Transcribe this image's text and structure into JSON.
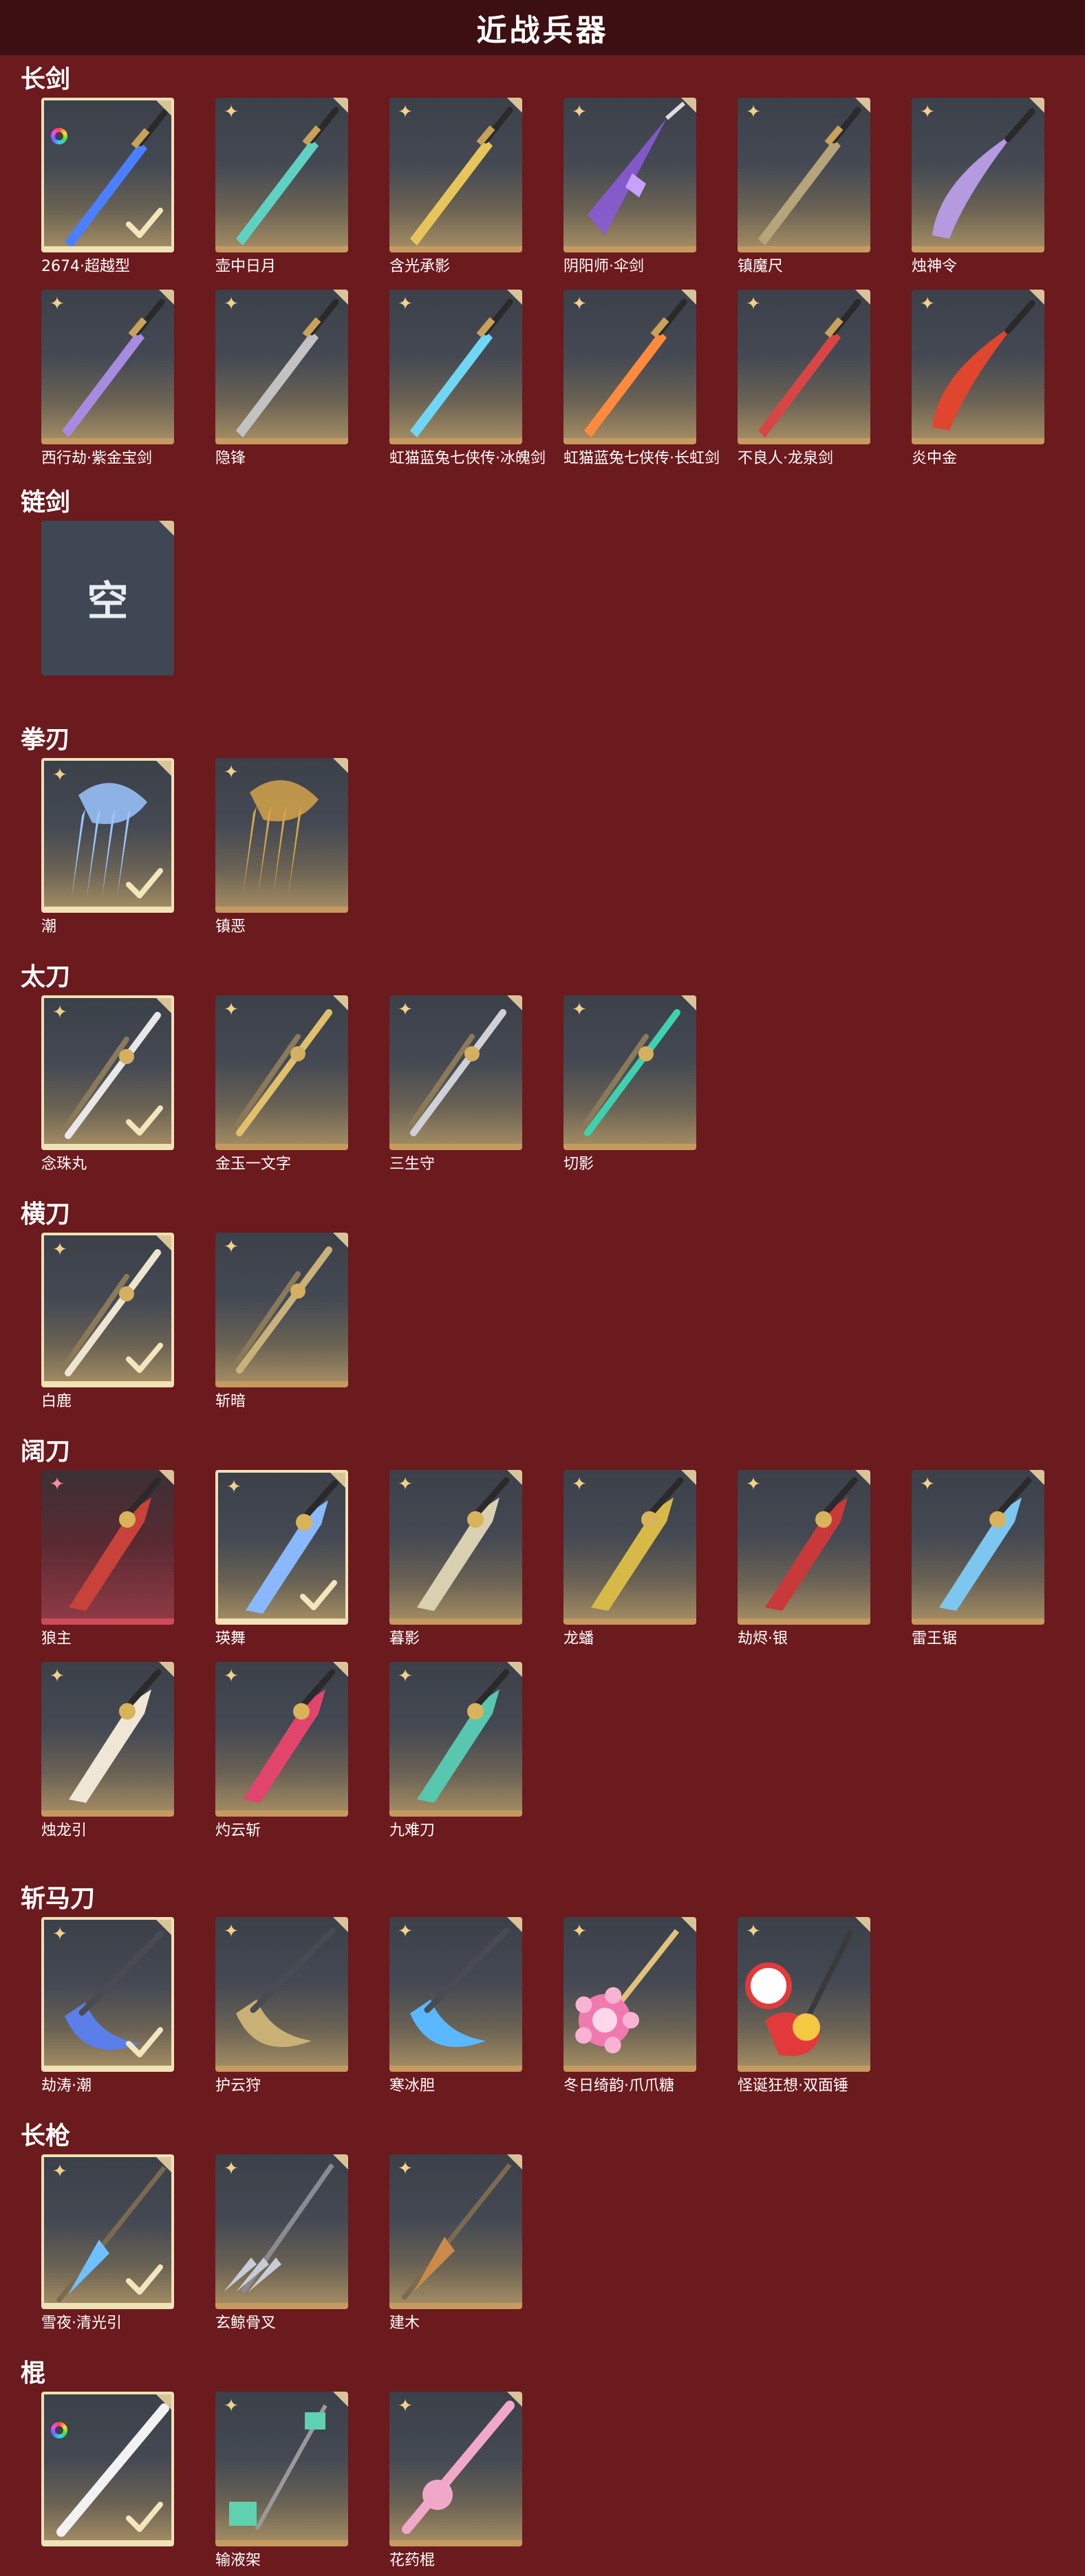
{
  "header": {
    "title": "近战兵器"
  },
  "sections": [
    {
      "title": "长剑",
      "items": [
        {
          "name": "2674·超越型",
          "badge": "rainbow",
          "selected": true,
          "color": "#4a7fff",
          "style": "sword"
        },
        {
          "name": "壶中日月",
          "badge": "star",
          "selected": false,
          "color": "#5fd1c2",
          "style": "sword"
        },
        {
          "name": "含光承影",
          "badge": "star",
          "selected": false,
          "color": "#e7c55a",
          "style": "sword"
        },
        {
          "name": "阴阳师·伞剑",
          "badge": "star",
          "selected": false,
          "color": "#8a5ad6",
          "style": "umbrella"
        },
        {
          "name": "镇魔尺",
          "badge": "star",
          "selected": false,
          "color": "#b6a47b",
          "style": "sword"
        },
        {
          "name": "烛神令",
          "badge": "star",
          "selected": false,
          "color": "#b59ae0",
          "style": "curved"
        },
        {
          "name": "西行劫·紫金宝剑",
          "badge": "star",
          "selected": false,
          "color": "#a78be0",
          "style": "sword"
        },
        {
          "name": "隐锋",
          "badge": "star",
          "selected": false,
          "color": "#c2c2c2",
          "style": "sword"
        },
        {
          "name": "虹猫蓝兔七侠传·冰魄剑",
          "badge": "star",
          "selected": false,
          "color": "#6fd6f3",
          "style": "sword"
        },
        {
          "name": "虹猫蓝兔七侠传·长虹剑",
          "badge": "star",
          "selected": false,
          "color": "#ff8a3d",
          "style": "sword"
        },
        {
          "name": "不良人·龙泉剑",
          "badge": "star",
          "selected": false,
          "color": "#d94545",
          "style": "sword"
        },
        {
          "name": "炎中金",
          "badge": "star",
          "selected": false,
          "color": "#e0452e",
          "style": "curved"
        }
      ]
    },
    {
      "title": "链剑",
      "items": [
        {
          "name": "",
          "badge": "none",
          "selected": false,
          "empty": true,
          "empty_text": "空"
        }
      ]
    },
    {
      "title": "拳刃",
      "items": [
        {
          "name": "潮",
          "badge": "star",
          "selected": true,
          "color": "#9cc6ff",
          "style": "claw"
        },
        {
          "name": "镇恶",
          "badge": "star",
          "selected": false,
          "color": "#d4a34a",
          "style": "claw"
        }
      ]
    },
    {
      "title": "太刀",
      "items": [
        {
          "name": "念珠丸",
          "badge": "star",
          "selected": true,
          "color": "#e8e8e8",
          "style": "katana"
        },
        {
          "name": "金玉一文字",
          "badge": "star",
          "selected": false,
          "color": "#e0c06a",
          "style": "katana"
        },
        {
          "name": "三生守",
          "badge": "star",
          "selected": false,
          "color": "#d0d0d8",
          "style": "katana"
        },
        {
          "name": "切影",
          "badge": "star",
          "selected": false,
          "color": "#3ed1b0",
          "style": "katana"
        }
      ]
    },
    {
      "title": "横刀",
      "items": [
        {
          "name": "白鹿",
          "badge": "star",
          "selected": true,
          "color": "#ece5cf",
          "style": "katana"
        },
        {
          "name": "斩暗",
          "badge": "star",
          "selected": false,
          "color": "#c8b27a",
          "style": "katana"
        }
      ]
    },
    {
      "title": "阔刀",
      "items": [
        {
          "name": "狼主",
          "badge": "pinkstar",
          "selected": false,
          "red": true,
          "color": "#c8423a",
          "style": "broad"
        },
        {
          "name": "瑛舞",
          "badge": "star",
          "selected": true,
          "color": "#8ab8ff",
          "style": "broad"
        },
        {
          "name": "暮影",
          "badge": "star",
          "selected": false,
          "color": "#d8d0b0",
          "style": "broad"
        },
        {
          "name": "龙蟠",
          "badge": "star",
          "selected": false,
          "color": "#d7b948",
          "style": "broad"
        },
        {
          "name": "劫烬·银",
          "badge": "star",
          "selected": false,
          "color": "#c9393a",
          "style": "broad"
        },
        {
          "name": "雷王锯",
          "badge": "star",
          "selected": false,
          "color": "#7cc6ef",
          "style": "broad"
        },
        {
          "name": "烛龙引",
          "badge": "star",
          "selected": false,
          "color": "#efe6d6",
          "style": "broad"
        },
        {
          "name": "灼云斩",
          "badge": "star",
          "selected": false,
          "color": "#e2456b",
          "style": "broad"
        },
        {
          "name": "九难刀",
          "badge": "star",
          "selected": false,
          "color": "#58c7b0",
          "style": "broad"
        }
      ]
    },
    {
      "title": "斩马刀",
      "items": [
        {
          "name": "劫涛·潮",
          "badge": "star",
          "selected": true,
          "color": "#5b7ee8",
          "style": "glaive"
        },
        {
          "name": "护云狩",
          "badge": "star",
          "selected": false,
          "color": "#c9b074",
          "style": "glaive"
        },
        {
          "name": "寒冰胆",
          "badge": "star",
          "selected": false,
          "color": "#59b8ff",
          "style": "glaive"
        },
        {
          "name": "冬日绮韵·爪爪糖",
          "badge": "star",
          "selected": false,
          "color": "#f07ab0",
          "style": "candy"
        },
        {
          "name": "怪诞狂想·双面锤",
          "badge": "star",
          "selected": false,
          "color": "#e23a3a",
          "style": "hammer"
        }
      ]
    },
    {
      "title": "长枪",
      "items": [
        {
          "name": "雪夜·清光引",
          "badge": "star",
          "selected": true,
          "color": "#6fc0ff",
          "style": "spear"
        },
        {
          "name": "玄鲸骨叉",
          "badge": "star",
          "selected": false,
          "color": "#c8ccd6",
          "style": "trident"
        },
        {
          "name": "建木",
          "badge": "star",
          "selected": false,
          "color": "#c98a4a",
          "style": "spear"
        }
      ]
    },
    {
      "title": "棍",
      "items": [
        {
          "name": "",
          "badge": "rainbow",
          "selected": true,
          "color": "#f2f2f2",
          "style": "staff"
        },
        {
          "name": "输液架",
          "badge": "star",
          "selected": false,
          "color": "#5fd0b0",
          "style": "iv"
        },
        {
          "name": "花药棍",
          "badge": "star",
          "selected": false,
          "color": "#f0a8c8",
          "style": "staff"
        }
      ]
    }
  ]
}
